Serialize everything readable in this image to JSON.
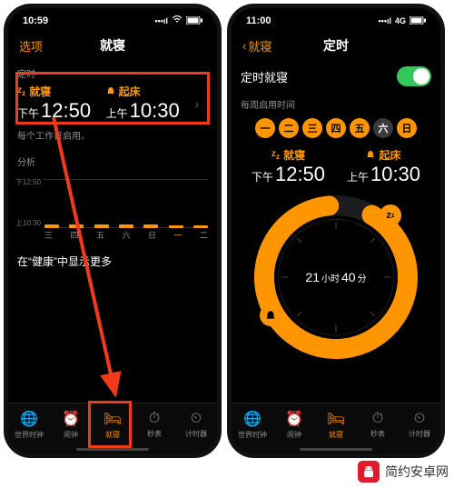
{
  "colors": {
    "accent": "#ff9500",
    "green": "#34c759",
    "red": "#f13a1a"
  },
  "left": {
    "status": {
      "time": "10:59",
      "signal": "•••ıl",
      "wifi": "⌃",
      "battery": "▮"
    },
    "nav": {
      "left": "选项",
      "title": "就寝"
    },
    "sec_timer": "定时",
    "bed": {
      "icon": "z",
      "label": "就寝",
      "ampm": "下午",
      "time": "12:50"
    },
    "wake": {
      "icon": "bell",
      "label": "起床",
      "ampm": "上午",
      "time": "10:30"
    },
    "enabled_note": "每个工作日启用。",
    "sec_analysis": "分析",
    "chart_y_top": "下12:50",
    "chart_y_bot": "上10:30",
    "chart_x": [
      "三",
      "四",
      "五",
      "六",
      "日",
      "一",
      "二"
    ],
    "health": "在“健康”中显示更多",
    "tabs": {
      "world": "世界时钟",
      "alarm": "闹钟",
      "bed": "就寝",
      "stopwatch": "秒表",
      "timer": "计时器"
    }
  },
  "right": {
    "status": {
      "time": "11:00",
      "net": "4G",
      "signal": "•••ıl",
      "battery": "▮"
    },
    "nav": {
      "back": "就寝",
      "title": "定时"
    },
    "row_switch_label": "定时就寝",
    "sec_weekdays": "每周启用时间",
    "days": [
      "一",
      "二",
      "三",
      "四",
      "五",
      "六",
      "日"
    ],
    "days_on": [
      true,
      true,
      true,
      true,
      true,
      false,
      true
    ],
    "bed": {
      "label": "就寝",
      "ampm": "下午",
      "time": "12:50"
    },
    "wake": {
      "label": "起床",
      "ampm": "上午",
      "time": "10:30"
    },
    "duration": {
      "h": "21",
      "h_u": "小时",
      "m": "40",
      "m_u": "分"
    },
    "tabs": {
      "world": "世界时钟",
      "alarm": "闹钟",
      "bed": "就寝",
      "stopwatch": "秒表",
      "timer": "计时器"
    }
  },
  "watermark": "简约安卓网"
}
